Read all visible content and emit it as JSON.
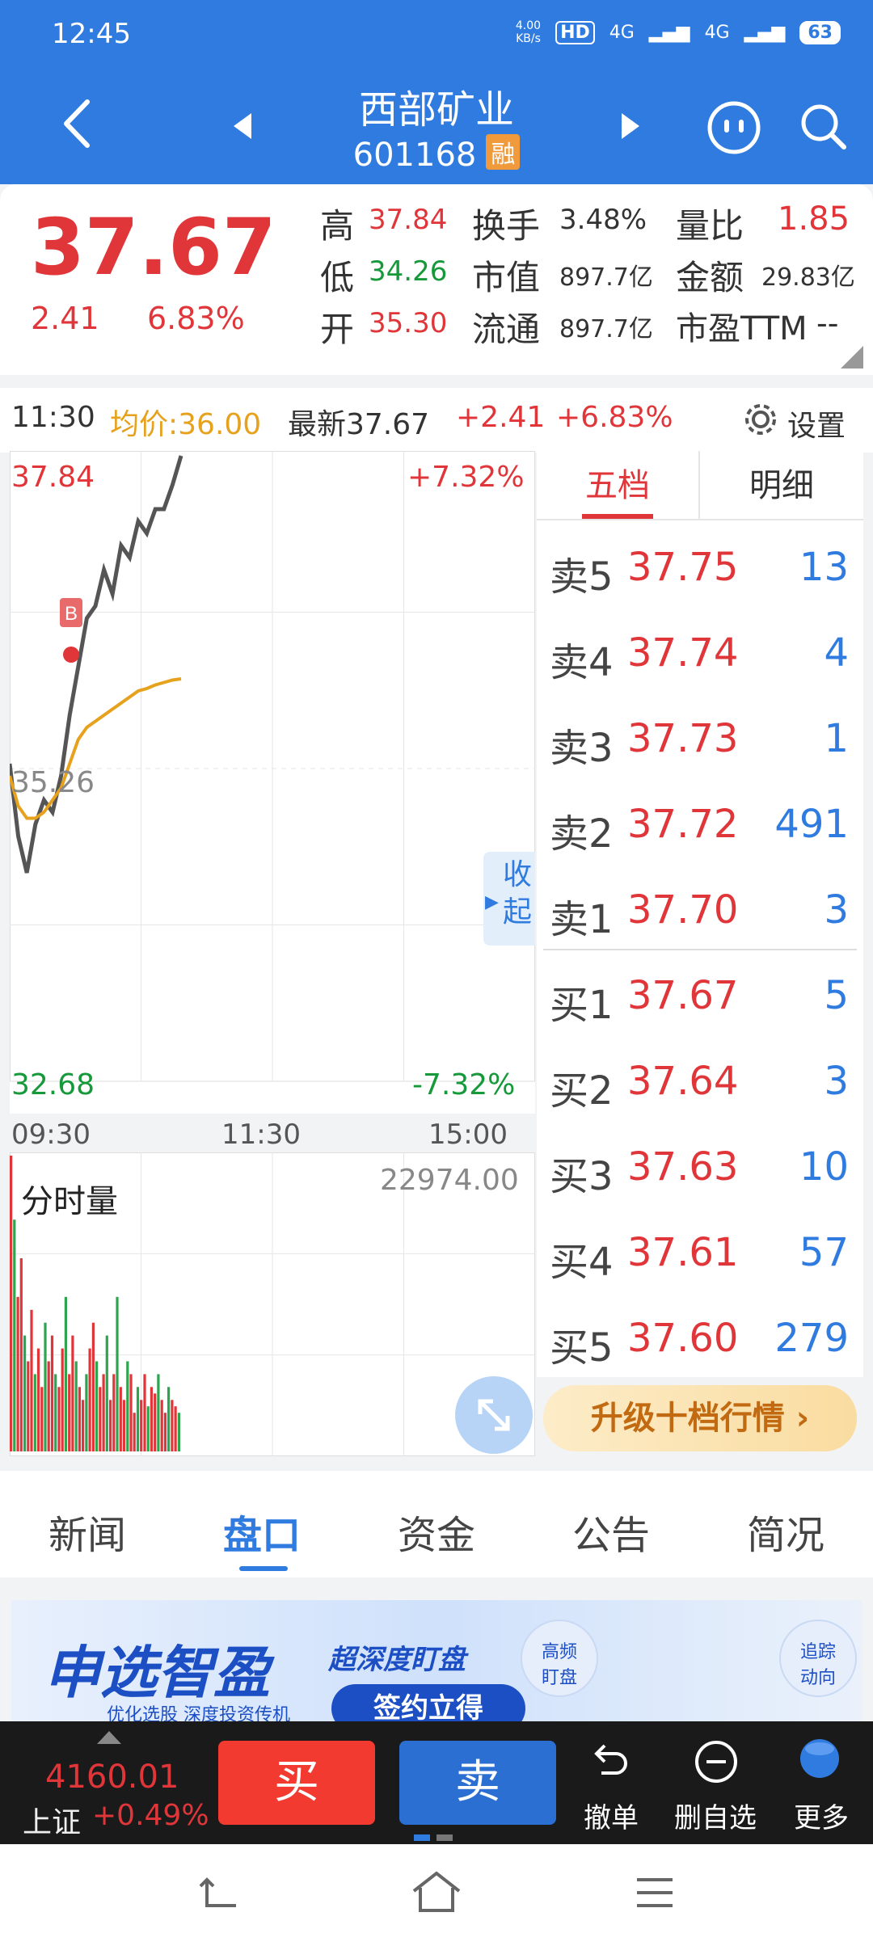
{
  "status": {
    "time": "12:45",
    "speed_value": "4.00",
    "speed_unit": "KB/s",
    "hd": "HD",
    "net1": "4G",
    "net2": "4G",
    "battery": "63"
  },
  "header": {
    "title": "西部矿业",
    "code": "601168",
    "margin_badge": "融"
  },
  "quote": {
    "price": "37.67",
    "change": "2.41",
    "change_pct": "6.83%",
    "high_label": "高",
    "high": "37.84",
    "low_label": "低",
    "low": "34.26",
    "open_label": "开",
    "open": "35.30",
    "turnover_label": "换手",
    "turnover": "3.48%",
    "mktcap_label": "市值",
    "mktcap": "897.7亿",
    "float_label": "流通",
    "float": "897.7亿",
    "vol_ratio_label": "量比",
    "vol_ratio": "1.85",
    "amount_label": "金额",
    "amount": "29.83亿",
    "pe_label": "市盈TTM",
    "pe": "--"
  },
  "chart_toolbar": {
    "time": "11:30",
    "avg_price": "均价:36.00",
    "latest": "最新37.67",
    "change": "+2.41",
    "change_pct": "+6.83%",
    "settings": "设置"
  },
  "chart": {
    "top_price": "37.84",
    "top_pct": "+7.32%",
    "mid_price": "35.26",
    "bottom_price": "32.68",
    "bottom_pct": "-7.32%",
    "time_start": "09:30",
    "time_mid": "11:30",
    "time_end": "15:00",
    "collapse": "收起",
    "marker": "B",
    "vol_title": "分时量",
    "vol_max": "22974.00"
  },
  "chart_data": [
    {
      "type": "line",
      "title": "",
      "ylim": [
        32.68,
        37.84
      ],
      "x_ticks": [
        "09:30",
        "11:30",
        "15:00"
      ],
      "series": [
        {
          "name": "",
          "color": "#555555",
          "values": [
            35.3,
            34.7,
            34.4,
            34.8,
            35.0,
            34.9,
            35.2,
            35.7,
            36.1,
            36.5,
            36.6,
            36.9,
            36.7,
            37.1,
            37.0,
            37.3,
            37.2,
            37.4,
            37.4,
            37.6,
            37.84
          ]
        },
        {
          "name": "",
          "color": "#e6a11d",
          "values": [
            35.2,
            34.95,
            34.85,
            34.85,
            34.9,
            35.0,
            35.1,
            35.3,
            35.5,
            35.6,
            35.65,
            35.7,
            35.75,
            35.8,
            35.85,
            35.9,
            35.92,
            35.95,
            35.97,
            35.99,
            36.0
          ]
        }
      ]
    },
    {
      "type": "bar",
      "title": "分时量",
      "ylim": [
        0,
        22974
      ],
      "values": [
        22974,
        18000,
        12000,
        15000,
        9000,
        7000,
        11000,
        6000,
        8000,
        5000,
        10000,
        7000,
        9000,
        6000,
        5000,
        8000,
        12000,
        6000,
        9000,
        7000,
        5000,
        4000,
        6000,
        8000,
        10000,
        7000,
        5000,
        6000,
        9000,
        4000,
        6000,
        12000,
        5000,
        4000,
        7000,
        6000,
        3000,
        5000,
        4000,
        6000,
        3500,
        5000,
        4500,
        6000,
        4000,
        3000,
        5000,
        4000,
        3500,
        3000
      ]
    }
  ],
  "orderbook": {
    "tab_five": "五档",
    "tab_detail": "明细",
    "asks": [
      {
        "label": "卖5",
        "price": "37.75",
        "vol": "13"
      },
      {
        "label": "卖4",
        "price": "37.74",
        "vol": "4"
      },
      {
        "label": "卖3",
        "price": "37.73",
        "vol": "1"
      },
      {
        "label": "卖2",
        "price": "37.72",
        "vol": "491"
      },
      {
        "label": "卖1",
        "price": "37.70",
        "vol": "3"
      }
    ],
    "bids": [
      {
        "label": "买1",
        "price": "37.67",
        "vol": "5"
      },
      {
        "label": "买2",
        "price": "37.64",
        "vol": "3"
      },
      {
        "label": "买3",
        "price": "37.63",
        "vol": "10"
      },
      {
        "label": "买4",
        "price": "37.61",
        "vol": "57"
      },
      {
        "label": "买5",
        "price": "37.60",
        "vol": "279"
      }
    ],
    "upgrade": "升级十档行情 ›"
  },
  "tabs": [
    "新闻",
    "盘口",
    "资金",
    "公告",
    "简况"
  ],
  "banner": {
    "brand": "申选智盈",
    "slogan": "超深度盯盘",
    "cta": "签约立得",
    "sub": "优化选股 深度投资传机",
    "badge1": "高频\n盯盘",
    "badge2": "追踪\n动向"
  },
  "bottom": {
    "index_value": "4160.01",
    "index_name": "上证",
    "index_pct": "+0.49%",
    "buy": "买",
    "sell": "卖",
    "cancel": "撤单",
    "remove_watch": "删自选",
    "more": "更多"
  }
}
